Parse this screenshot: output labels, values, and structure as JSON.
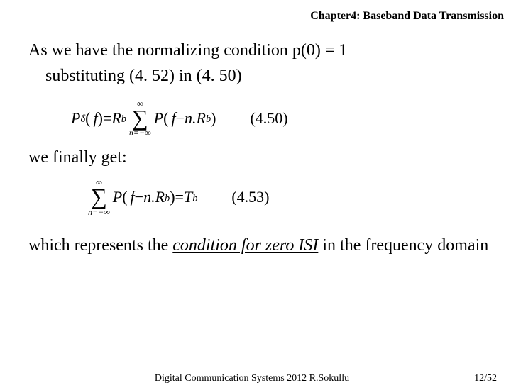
{
  "header": {
    "title": "Chapter4: Baseband Data Transmission"
  },
  "body": {
    "line1": "As we have the normalizing condition p(0) = 1",
    "line2": "substituting (4. 52) in (4. 50)",
    "eq1": {
      "lhs_P": "P",
      "lhs_sub": "δ",
      "lhs_arg_open": "(",
      "lhs_arg_var": "f",
      "lhs_arg_close": ")",
      "eq_sign": " = ",
      "Rb_R": "R",
      "Rb_b": "b",
      "sum_top": "∞",
      "sum_bot": "n=−∞",
      "term_P": "P",
      "term_open": "(",
      "term_f": "f",
      "term_minus": " − ",
      "term_nR": "n.R",
      "term_b": "b",
      "term_close": ")",
      "label": "(4.50)"
    },
    "line3": "we finally get:",
    "eq2": {
      "sum_top": "∞",
      "sum_bot": "n=−∞",
      "term_P": "P",
      "term_open": "(",
      "term_f": "f",
      "term_minus": " − ",
      "term_nR": "n.R",
      "term_b": "b",
      "term_close": ")",
      "eq_sign": " = ",
      "T": "T",
      "Tb": "b",
      "label": "(4.53)"
    },
    "conclusion_pre": "which represents the ",
    "conclusion_em": "condition for zero ISI",
    "conclusion_post": " in the frequency domain"
  },
  "footer": {
    "center": "Digital Communication Systems 2012 R.Sokullu",
    "right": "12/52"
  }
}
